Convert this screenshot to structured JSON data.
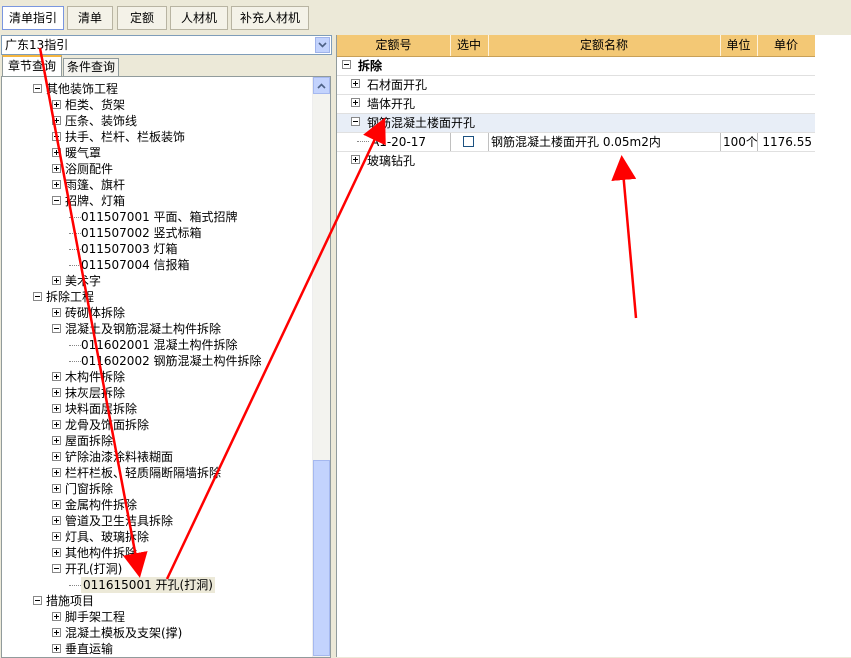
{
  "top_tabs": [
    "清单指引",
    "清单",
    "定额",
    "人材机",
    "补充人材机"
  ],
  "left": {
    "combo_value": "广东13指引",
    "subtabs": [
      "章节查询",
      "条件查询"
    ],
    "tree": [
      {
        "label": "其他装饰工程",
        "expander": "minus"
      },
      {
        "label": "柜类、货架",
        "expander": "plus"
      },
      {
        "label": "压条、装饰线",
        "expander": "plus"
      },
      {
        "label": "扶手、栏杆、栏板装饰",
        "expander": "plus"
      },
      {
        "label": "暖气罩",
        "expander": "plus"
      },
      {
        "label": "浴厕配件",
        "expander": "plus"
      },
      {
        "label": "雨篷、旗杆",
        "expander": "plus"
      },
      {
        "label": "招牌、灯箱",
        "expander": "minus"
      },
      {
        "label": "011507001  平面、箱式招牌",
        "expander": "leaf"
      },
      {
        "label": "011507002  竖式标箱",
        "expander": "leaf"
      },
      {
        "label": "011507003  灯箱",
        "expander": "leaf"
      },
      {
        "label": "011507004  信报箱",
        "expander": "leaf"
      },
      {
        "label": "美术字",
        "expander": "plus"
      },
      {
        "label": "拆除工程",
        "expander": "minus"
      },
      {
        "label": "砖砌体拆除",
        "expander": "plus"
      },
      {
        "label": "混凝土及钢筋混凝土构件拆除",
        "expander": "minus"
      },
      {
        "label": "011602001  混凝土构件拆除",
        "expander": "leaf"
      },
      {
        "label": "011602002  钢筋混凝土构件拆除",
        "expander": "leaf"
      },
      {
        "label": "木构件拆除",
        "expander": "plus"
      },
      {
        "label": "抹灰层拆除",
        "expander": "plus"
      },
      {
        "label": "块料面层拆除",
        "expander": "plus"
      },
      {
        "label": "龙骨及饰面拆除",
        "expander": "plus"
      },
      {
        "label": "屋面拆除",
        "expander": "plus"
      },
      {
        "label": "铲除油漆涂料裱糊面",
        "expander": "plus"
      },
      {
        "label": "栏杆栏板、轻质隔断隔墙拆除",
        "expander": "plus"
      },
      {
        "label": "门窗拆除",
        "expander": "plus"
      },
      {
        "label": "金属构件拆除",
        "expander": "plus"
      },
      {
        "label": "管道及卫生洁具拆除",
        "expander": "plus"
      },
      {
        "label": "灯具、玻璃拆除",
        "expander": "plus"
      },
      {
        "label": "其他构件拆除",
        "expander": "plus"
      },
      {
        "label": "开孔(打洞)",
        "expander": "minus"
      },
      {
        "label": "011615001  开孔(打洞)",
        "expander": "leaf"
      },
      {
        "label": "措施项目",
        "expander": "minus"
      },
      {
        "label": "脚手架工程",
        "expander": "plus"
      },
      {
        "label": "混凝土模板及支架(撑)",
        "expander": "plus"
      },
      {
        "label": "垂直运输",
        "expander": "plus"
      }
    ]
  },
  "grid": {
    "headers": [
      "定额号",
      "选中",
      "定额名称",
      "单位",
      "单价"
    ],
    "group": "拆除",
    "rows": [
      {
        "type": "sub",
        "label": "石材面开孔",
        "expander": "plus"
      },
      {
        "type": "sub",
        "label": "墙体开孔",
        "expander": "plus"
      },
      {
        "type": "sub",
        "label": "钢筋混凝土楼面开孔",
        "expander": "minus"
      },
      {
        "type": "item",
        "code": "A1-20-17",
        "checked": false,
        "name": "钢筋混凝土楼面开孔 0.05m2内",
        "unit": "100个",
        "price": "1176.55"
      },
      {
        "type": "sub",
        "label": "玻璃钻孔",
        "expander": "plus"
      }
    ]
  },
  "colors": {
    "arrow": "#ff0000",
    "grid_header": "#f3c875",
    "tab_accent": "#f5b53f"
  }
}
